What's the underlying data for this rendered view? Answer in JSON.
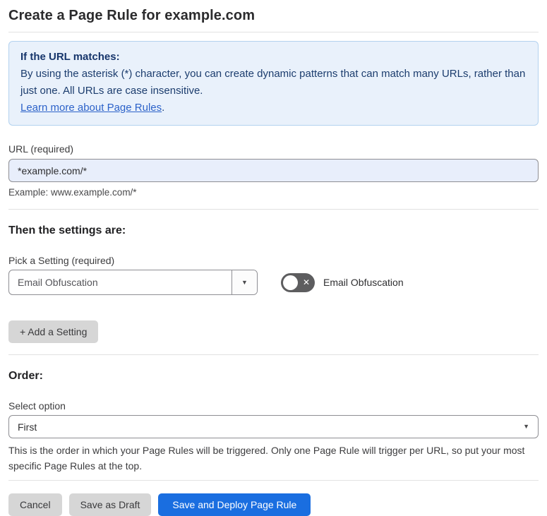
{
  "page": {
    "title": "Create a Page Rule for example.com"
  },
  "info_box": {
    "heading": "If the URL matches:",
    "body": "By using the asterisk (*) character, you can create dynamic patterns that can match many URLs, rather than just one. All URLs are case insensitive.",
    "link": "Learn more about Page Rules",
    "link_suffix": "."
  },
  "url_field": {
    "label": "URL (required)",
    "value": "*example.com/*",
    "example": "Example: www.example.com/*"
  },
  "settings_section": {
    "heading": "Then the settings are:",
    "picker_label": "Pick a Setting (required)",
    "picker_value": "Email Obfuscation",
    "toggle_label": "Email Obfuscation",
    "toggle_state": "off",
    "add_button_label": "+ Add a Setting"
  },
  "order_section": {
    "heading": "Order:",
    "select_label": "Select option",
    "select_value": "First",
    "help": "This is the order in which your Page Rules will be triggered. Only one Page Rule will trigger per URL, so put your most specific Page Rules at the top."
  },
  "footer": {
    "cancel_label": "Cancel",
    "save_draft_label": "Save as Draft",
    "save_deploy_label": "Save and Deploy Page Rule"
  },
  "icons": {
    "dropdown_arrow": "▼",
    "toggle_off_x": "✕"
  },
  "colors": {
    "info_bg": "#e9f1fb",
    "info_border": "#b3d2ef",
    "info_text": "#1c3d6e",
    "link_blue": "#2c62c9",
    "input_bg": "#e8eefb",
    "primary_button": "#1a6ee0",
    "gray_button": "#d6d6d6",
    "toggle_off_track": "#5d5d5f"
  }
}
